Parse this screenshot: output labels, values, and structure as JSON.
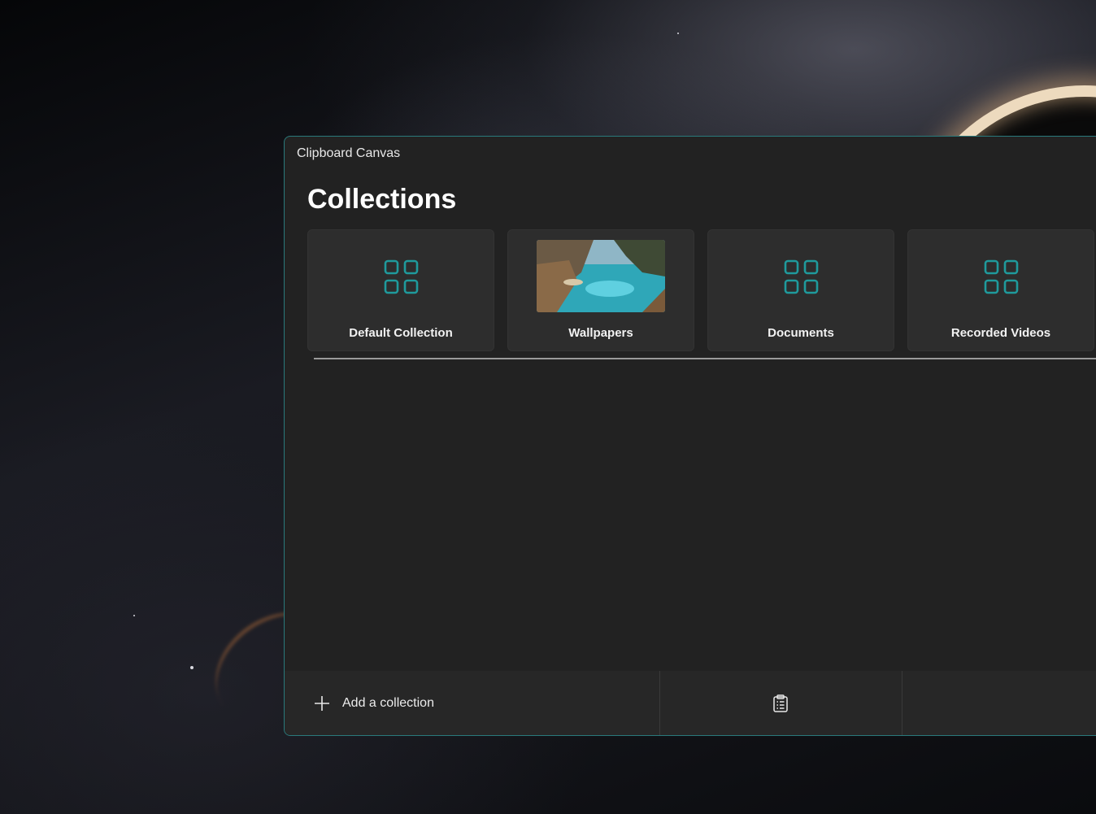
{
  "window": {
    "title": "Clipboard Canvas",
    "accent": "#2a8a8c"
  },
  "page": {
    "heading": "Collections"
  },
  "collections": [
    {
      "label": "Default Collection",
      "icon": "grid-icon"
    },
    {
      "label": "Wallpapers",
      "icon": "landscape-thumbnail"
    },
    {
      "label": "Documents",
      "icon": "grid-icon"
    },
    {
      "label": "Recorded Videos",
      "icon": "grid-icon"
    }
  ],
  "bottombar": {
    "add_label": "Add a collection",
    "add_icon": "plus-icon",
    "clipboard_icon": "clipboard-icon"
  }
}
